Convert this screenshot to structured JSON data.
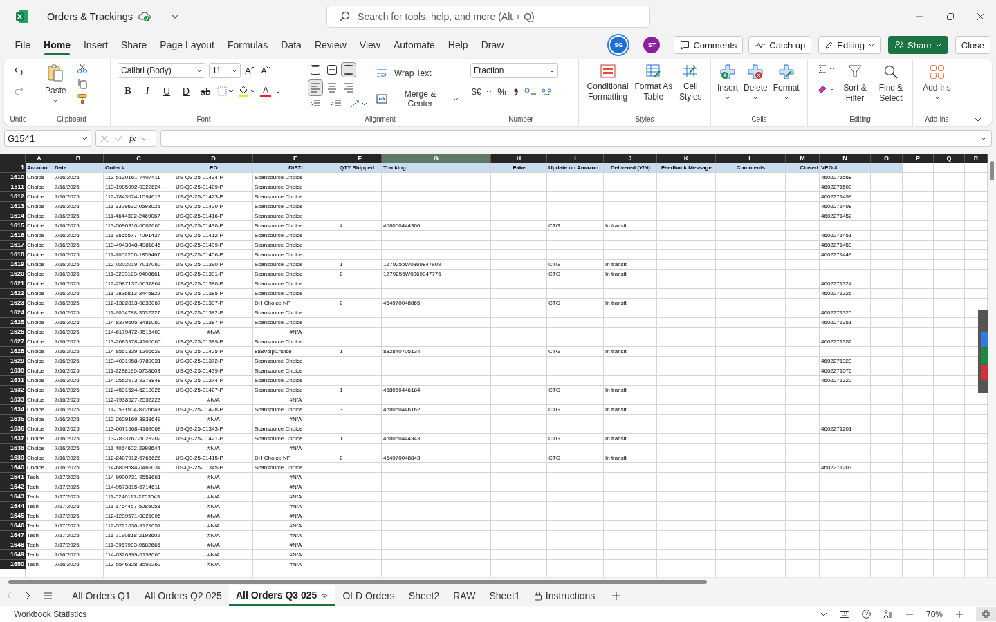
{
  "title_bar": {
    "title": "Orders & Trackings",
    "search_placeholder": "Search for tools, help, and more (Alt + Q)"
  },
  "menu": [
    {
      "label": "File",
      "selected": false
    },
    {
      "label": "Home",
      "selected": true
    },
    {
      "label": "Insert",
      "selected": false
    },
    {
      "label": "Share",
      "selected": false
    },
    {
      "label": "Page Layout",
      "selected": false
    },
    {
      "label": "Formulas",
      "selected": false
    },
    {
      "label": "Data",
      "selected": false
    },
    {
      "label": "Review",
      "selected": false
    },
    {
      "label": "View",
      "selected": false
    },
    {
      "label": "Automate",
      "selected": false
    },
    {
      "label": "Help",
      "selected": false
    },
    {
      "label": "Draw",
      "selected": false
    }
  ],
  "avatars": [
    {
      "initials": "SG",
      "color": "#1f6fd1"
    },
    {
      "initials": "ST",
      "color": "#8b1fa0"
    }
  ],
  "actions": {
    "comments": "Comments",
    "catch_up": "Catch up",
    "editing": "Editing",
    "share": "Share",
    "close": "Close"
  },
  "ribbon": {
    "undo": {
      "label": "Undo"
    },
    "clipboard": {
      "paste": "Paste",
      "label": "Clipboard"
    },
    "font": {
      "name": "Calibri (Body)",
      "size": "11",
      "grow": "A",
      "shrink": "A",
      "bold": "B",
      "italic": "I",
      "underline": "U",
      "double_underline": "D",
      "strikethrough": "ab",
      "color_letter": "A",
      "label": "Font"
    },
    "alignment": {
      "vertical_buttons": [
        {
          "selected": false
        },
        {
          "selected": false
        },
        {
          "selected": true
        }
      ],
      "horizontal_buttons": [
        {
          "selected": true
        },
        {
          "selected": false
        },
        {
          "selected": false
        }
      ],
      "wrap": "Wrap Text",
      "merge": "Merge & Center",
      "label": "Alignment"
    },
    "number": {
      "format": "Fraction",
      "currency": "$€",
      "percent": "%",
      "label": "Number"
    },
    "styles": {
      "conditional": "Conditional Formatting",
      "table": "Format As Table",
      "cell": "Cell Styles",
      "label": "Styles"
    },
    "cells": {
      "insert": "Insert",
      "delete": "Delete",
      "format": "Format",
      "label": "Cells"
    },
    "editing": {
      "sort": "Sort & Filter",
      "find": "Find & Select",
      "label": "Editing"
    },
    "addins": {
      "button": "Add-ins",
      "label": "Add-ins"
    }
  },
  "formula_bar": {
    "name_box": "G1541",
    "function_label": "fx"
  },
  "sheet": {
    "header_row_number": "1",
    "columns": [
      {
        "letter": "A",
        "heading": "Account",
        "selected": false
      },
      {
        "letter": "B",
        "heading": "Date",
        "selected": false
      },
      {
        "letter": "C",
        "heading": "Order #",
        "selected": false
      },
      {
        "letter": "D",
        "heading": "PO",
        "selected": false
      },
      {
        "letter": "E",
        "heading": "DISTI",
        "selected": false
      },
      {
        "letter": "F",
        "heading": "QTY Shipped",
        "selected": false
      },
      {
        "letter": "G",
        "heading": "Tracking",
        "selected": true
      },
      {
        "letter": "H",
        "heading": "Fake",
        "selected": false
      },
      {
        "letter": "I",
        "heading": "Update on Amazon",
        "selected": false
      },
      {
        "letter": "J",
        "heading": "Delivered (Y/N)",
        "selected": false
      },
      {
        "letter": "K",
        "heading": "Feedback Message",
        "selected": false
      },
      {
        "letter": "L",
        "heading": "Comments",
        "selected": false
      },
      {
        "letter": "M",
        "heading": "Closed",
        "selected": false
      },
      {
        "letter": "N",
        "heading": "VPO #",
        "selected": false
      },
      {
        "letter": "O",
        "selected": false
      },
      {
        "letter": "P",
        "selected": false
      },
      {
        "letter": "Q",
        "selected": false
      },
      {
        "letter": "R",
        "selected": false
      }
    ],
    "rows": [
      {
        "number": "1610",
        "lookup_error": false,
        "account": "Choice",
        "date": "7/16/2025",
        "order": "113-5130161-7407411",
        "po": "US-Q3-25-01434-P",
        "disti": "Scansource Choice",
        "vpo": "4602271568"
      },
      {
        "number": "1611",
        "lookup_error": false,
        "account": "Choice",
        "date": "7/16/2025",
        "order": "113-1985992-0322624",
        "po": "US-Q3-25-01429-P",
        "disti": "Scansource Choice",
        "vpo": "4602271500"
      },
      {
        "number": "1612",
        "lookup_error": false,
        "account": "Choice",
        "date": "7/16/2025",
        "order": "112-7843624-1594613",
        "po": "US-Q3-25-01423-P",
        "disti": "Scansource Choice",
        "vpo": "4602271499"
      },
      {
        "number": "1613",
        "lookup_error": false,
        "account": "Choice",
        "date": "7/16/2025",
        "order": "111-3329632-0593025",
        "po": "US-Q3-25-01420-P",
        "disti": "Scansource Choice",
        "vpo": "4602271498"
      },
      {
        "number": "1614",
        "lookup_error": false,
        "account": "Choice",
        "date": "7/16/2025",
        "order": "111-4644382-2469067",
        "po": "US-Q3-25-01416-P",
        "disti": "Scansource Choice",
        "vpo": "4602271452"
      },
      {
        "number": "1615",
        "lookup_error": false,
        "account": "Choice",
        "date": "7/16/2025",
        "order": "113-5090310-6002666",
        "po": "US-Q3-25-01430-P",
        "disti": "Scansource Choice",
        "qty": "4",
        "tracking": "458050444300",
        "update": "CTG",
        "delivered": "In transit"
      },
      {
        "number": "1616",
        "lookup_error": false,
        "account": "Choice",
        "date": "7/16/2025",
        "order": "111-9665577-7091437",
        "po": "US-Q3-25-01412-P",
        "disti": "Scansource Choice",
        "vpo": "4602271451"
      },
      {
        "number": "1617",
        "lookup_error": false,
        "account": "Choice",
        "date": "7/16/2025",
        "order": "113-4943948-4981845",
        "po": "US-Q3-25-01409-P",
        "disti": "Scansource Choice",
        "vpo": "4602271450"
      },
      {
        "number": "1618",
        "lookup_error": false,
        "account": "Choice",
        "date": "7/16/2025",
        "order": "111-1052250-1859467",
        "po": "US-Q3-25-01406-P",
        "disti": "Scansource Choice",
        "vpo": "4602271449"
      },
      {
        "number": "1619",
        "lookup_error": false,
        "account": "Choice",
        "date": "7/16/2025",
        "order": "112-0202019-7037060",
        "po": "US-Q3-25-01390-P",
        "disti": "Scansource Choice",
        "qty": "1",
        "tracking": "1Z79255W0369847909",
        "update": "CTG",
        "delivered": "In transit"
      },
      {
        "number": "1620",
        "lookup_error": false,
        "account": "Choice",
        "date": "7/16/2025",
        "order": "111-3283123-9498661",
        "po": "US-Q3-25-01391-P",
        "disti": "Scansource Choice",
        "qty": "2",
        "tracking": "1Z79255W0369847776",
        "update": "CTG",
        "delivered": "In transit"
      },
      {
        "number": "1621",
        "lookup_error": false,
        "account": "Choice",
        "date": "7/16/2025",
        "order": "112-2587137-6637864",
        "po": "US-Q3-25-01380-P",
        "disti": "Scansource Choice",
        "vpo": "4602271324"
      },
      {
        "number": "1622",
        "lookup_error": false,
        "account": "Choice",
        "date": "7/16/2025",
        "order": "111-2836813-3445822",
        "po": "US-Q3-25-01385-P",
        "disti": "Scansource Choice",
        "vpo": "4602271326"
      },
      {
        "number": "1623",
        "lookup_error": false,
        "account": "Choice",
        "date": "7/16/2025",
        "order": "112-1382813-0833067",
        "po": "US-Q3-25-01397-P",
        "disti": "DH Choice NP",
        "qty": "2",
        "tracking": "464970048865",
        "update": "CTG",
        "delivered": "In transit"
      },
      {
        "number": "1624",
        "lookup_error": false,
        "account": "Choice",
        "date": "7/16/2025",
        "order": "111-9054788-3032227",
        "po": "US-Q3-25-01382-P",
        "disti": "Scansource Choice",
        "vpo": "4602271325"
      },
      {
        "number": "1625",
        "lookup_error": false,
        "account": "Choice",
        "date": "7/16/2025",
        "order": "114-8379605-8481060",
        "po": "US-Q3-25-01387-P",
        "disti": "Scansource Choice",
        "vpo": "4602271351"
      },
      {
        "number": "1626",
        "lookup_error": true,
        "account": "Choice",
        "date": "7/16/2025",
        "order": "114-6179472-9515409",
        "po": "#N/A",
        "disti": "#N/A"
      },
      {
        "number": "1627",
        "lookup_error": false,
        "account": "Choice",
        "date": "7/16/2025",
        "order": "113-2083978-4165060",
        "po": "US-Q3-25-01389-P",
        "disti": "Scansource Choice",
        "vpo": "4602271352"
      },
      {
        "number": "1628",
        "lookup_error": false,
        "account": "Choice",
        "date": "7/16/2025",
        "order": "114-8551339-1306629",
        "po": "US-Q3-25-01425-P",
        "disti": "888VoipChoice",
        "qty": "1",
        "tracking": "882840705134",
        "update": "CTG",
        "delivered": "In transit"
      },
      {
        "number": "1629",
        "lookup_error": false,
        "account": "Choice",
        "date": "7/16/2025",
        "order": "113-4031958-9789031",
        "po": "US-Q3-25-01372-P",
        "disti": "Scansource Choice",
        "vpo": "4602271323"
      },
      {
        "number": "1630",
        "lookup_error": false,
        "account": "Choice",
        "date": "7/16/2025",
        "order": "111-2288195-5738603",
        "po": "US-Q3-25-01439-P",
        "disti": "Scansource Choice",
        "vpo": "4602271576"
      },
      {
        "number": "1631",
        "lookup_error": false,
        "account": "Choice",
        "date": "7/16/2025",
        "order": "114-2552973-9373848",
        "po": "US-Q3-25-01374-P",
        "disti": "Scansource Choice",
        "vpo": "4602271322"
      },
      {
        "number": "1632",
        "lookup_error": false,
        "account": "Choice",
        "date": "7/16/2025",
        "order": "112-4531524-5213026",
        "po": "US-Q3-25-01427-P",
        "disti": "Scansource Choice",
        "qty": "1",
        "tracking": "458050446184",
        "update": "CTG",
        "delivered": "In transit"
      },
      {
        "number": "1633",
        "lookup_error": true,
        "account": "Choice",
        "date": "7/16/2025",
        "order": "112-7938527-2552223",
        "po": "#N/A",
        "disti": "#N/A"
      },
      {
        "number": "1634",
        "lookup_error": false,
        "account": "Choice",
        "date": "7/16/2025",
        "order": "111-0531904-8726643",
        "po": "US-Q3-25-01428-P",
        "disti": "Scansource Choice",
        "qty": "3",
        "tracking": "458050446162",
        "update": "CTG",
        "delivered": "In transit"
      },
      {
        "number": "1635",
        "lookup_error": true,
        "account": "Choice",
        "date": "7/16/2025",
        "order": "112-2629169-3838649",
        "po": "#N/A",
        "disti": "#N/A"
      },
      {
        "number": "1636",
        "lookup_error": false,
        "account": "Choice",
        "date": "7/16/2025",
        "order": "113-0071568-4169068",
        "po": "US-Q3-25-01343-P",
        "disti": "Scansource Choice",
        "vpo": "4602271201"
      },
      {
        "number": "1637",
        "lookup_error": false,
        "account": "Choice",
        "date": "7/16/2025",
        "order": "113-7833767-6028202",
        "po": "US-Q3-25-01421-P",
        "disti": "Scansource Choice",
        "qty": "1",
        "tracking": "458050444343",
        "update": "CTG",
        "delivered": "In transit"
      },
      {
        "number": "1638",
        "lookup_error": true,
        "account": "Choice",
        "date": "7/16/2025",
        "order": "111-4054602-2998644",
        "po": "#N/A",
        "disti": "#N/A"
      },
      {
        "number": "1639",
        "lookup_error": false,
        "account": "Choice",
        "date": "7/16/2025",
        "order": "112-2487912-5766626",
        "po": "US-Q3-25-01415-P",
        "disti": "DH Choice NP",
        "qty": "2",
        "tracking": "464970048843",
        "update": "CTG",
        "delivered": "In transit"
      },
      {
        "number": "1640",
        "lookup_error": false,
        "account": "Choice",
        "date": "7/16/2025",
        "order": "114-6809584-0469034",
        "po": "US-Q3-25-01345-P",
        "disti": "Scansource Choice",
        "vpo": "4602271203"
      },
      {
        "number": "1641",
        "lookup_error": true,
        "account": "Tech",
        "date": "7/17/2025",
        "order": "114-9900731-9558661",
        "po": "#N/A",
        "disti": "#N/A"
      },
      {
        "number": "1642",
        "lookup_error": true,
        "account": "Tech",
        "date": "7/17/2025",
        "order": "114-9573815-5714611",
        "po": "#N/A",
        "disti": "#N/A"
      },
      {
        "number": "1643",
        "lookup_error": true,
        "account": "Tech",
        "date": "7/17/2025",
        "order": "111-0246117-2753043",
        "po": "#N/A",
        "disti": "#N/A"
      },
      {
        "number": "1644",
        "lookup_error": true,
        "account": "Tech",
        "date": "7/17/2025",
        "order": "111-1764457-5085058",
        "po": "#N/A",
        "disti": "#N/A"
      },
      {
        "number": "1645",
        "lookup_error": true,
        "account": "Tech",
        "date": "7/17/2025",
        "order": "112-1239571-0825005",
        "po": "#N/A",
        "disti": "#N/A"
      },
      {
        "number": "1646",
        "lookup_error": true,
        "account": "Tech",
        "date": "7/17/2025",
        "order": "112-5721636-9129057",
        "po": "#N/A",
        "disti": "#N/A"
      },
      {
        "number": "1647",
        "lookup_error": true,
        "account": "Tech",
        "date": "7/17/2025",
        "order": "111-2190818-2198602",
        "po": "#N/A",
        "disti": "#N/A"
      },
      {
        "number": "1648",
        "lookup_error": true,
        "account": "Tech",
        "date": "7/17/2025",
        "order": "111-3967983-9682665",
        "po": "#N/A",
        "disti": "#N/A"
      },
      {
        "number": "1649",
        "lookup_error": true,
        "account": "Tech",
        "date": "7/16/2025",
        "order": "114-0326399-6153060",
        "po": "#N/A",
        "disti": "#N/A"
      },
      {
        "number": "1650",
        "lookup_error": true,
        "account": "Tech",
        "date": "7/16/2025",
        "order": "113-5546828-3592262",
        "po": "#N/A",
        "disti": "#N/A"
      }
    ]
  },
  "sheet_tabs": [
    {
      "label": "All Orders Q1",
      "selected": false,
      "kind": "sheet"
    },
    {
      "label": "All Orders Q2 025",
      "selected": false,
      "kind": "sheet"
    },
    {
      "label": "All Orders Q3 025",
      "selected": true,
      "kind": "viewed"
    },
    {
      "label": "OLD Orders",
      "selected": false,
      "kind": "sheet"
    },
    {
      "label": "Sheet2",
      "selected": false,
      "kind": "sheet"
    },
    {
      "label": "RAW",
      "selected": false,
      "kind": "sheet"
    },
    {
      "label": "Sheet1",
      "selected": false,
      "kind": "sheet"
    },
    {
      "label": "Instructions",
      "selected": false,
      "kind": "protected"
    }
  ],
  "status_bar": {
    "statistics": "Workbook Statistics",
    "zoom": "70%"
  }
}
